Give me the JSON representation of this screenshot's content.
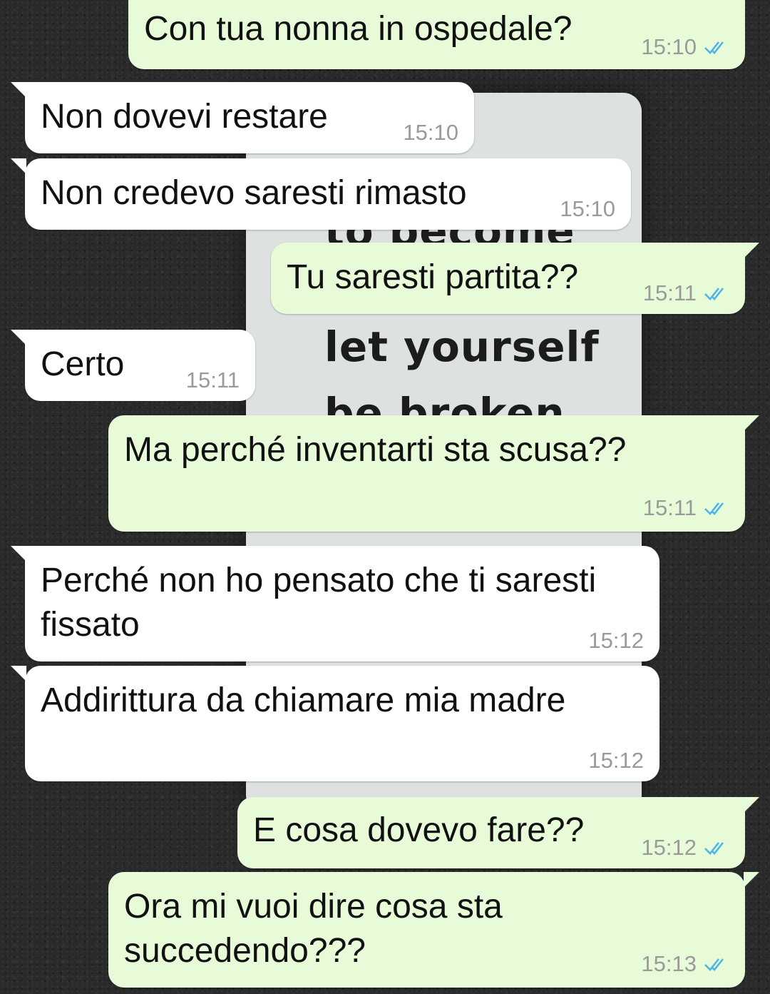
{
  "chat": {
    "messages": [
      {
        "dir": "out",
        "text": "Con tua nonna in ospedale?",
        "time": "15:10",
        "read": true
      },
      {
        "dir": "in",
        "text": "Non dovevi restare",
        "time": "15:10"
      },
      {
        "dir": "in",
        "text": "Non credevo saresti rimasto",
        "time": "15:10"
      },
      {
        "dir": "out",
        "text": "Tu saresti partita??",
        "time": "15:11",
        "read": true
      },
      {
        "dir": "in",
        "text": "Certo",
        "time": "15:11"
      },
      {
        "dir": "out",
        "text": "Ma perché inventarti sta scusa??",
        "time": "15:11",
        "read": true
      },
      {
        "dir": "in",
        "text": "Perché non ho pensato che ti saresti\nfissato",
        "time": "15:12"
      },
      {
        "dir": "in",
        "text": "Addirittura da chiamare mia madre",
        "time": "15:12"
      },
      {
        "dir": "out",
        "text": "E cosa dovevo fare??",
        "time": "15:12",
        "read": true
      },
      {
        "dir": "out",
        "text": "Ora mi vuoi dire cosa sta\nsuccedendo???",
        "time": "15:13",
        "read": true
      }
    ]
  },
  "wallpaper": {
    "line0": "to become",
    "line1": "let yourself",
    "line2": "be broken"
  },
  "colors": {
    "outgoing_bubble": "#e8fbd9",
    "incoming_bubble": "#ffffff",
    "read_ticks": "#4fb4e8",
    "timestamp": "#9a9a9a"
  },
  "icons": {
    "read_receipt": "double-check-icon"
  }
}
